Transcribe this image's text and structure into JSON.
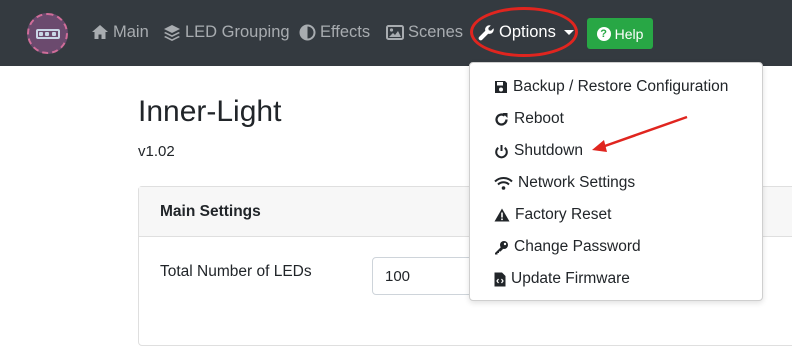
{
  "nav": {
    "items": [
      {
        "label": "Main",
        "icon": "home-icon"
      },
      {
        "label": "LED Grouping",
        "icon": "layers-icon"
      },
      {
        "label": "Effects",
        "icon": "adjust-icon"
      },
      {
        "label": "Scenes",
        "icon": "image-icon"
      }
    ],
    "options_label": "Options",
    "help_label": "Help"
  },
  "page": {
    "title": "Inner-Light",
    "version": "v1.02"
  },
  "card": {
    "title": "Main Settings",
    "field_label": "Total Number of LEDs",
    "field_value": "100"
  },
  "dropdown": {
    "items": [
      {
        "label": "Backup / Restore Configuration",
        "icon": "save-icon"
      },
      {
        "label": "Reboot",
        "icon": "redo-icon"
      },
      {
        "label": "Shutdown",
        "icon": "power-icon"
      },
      {
        "label": "Network Settings",
        "icon": "wifi-icon"
      },
      {
        "label": "Factory Reset",
        "icon": "warning-icon"
      },
      {
        "label": "Change Password",
        "icon": "key-icon"
      },
      {
        "label": "Update Firmware",
        "icon": "file-code-icon"
      }
    ]
  },
  "colors": {
    "navbar": "#343a40",
    "help_button": "#28a745",
    "annotation": "#e0251f"
  }
}
